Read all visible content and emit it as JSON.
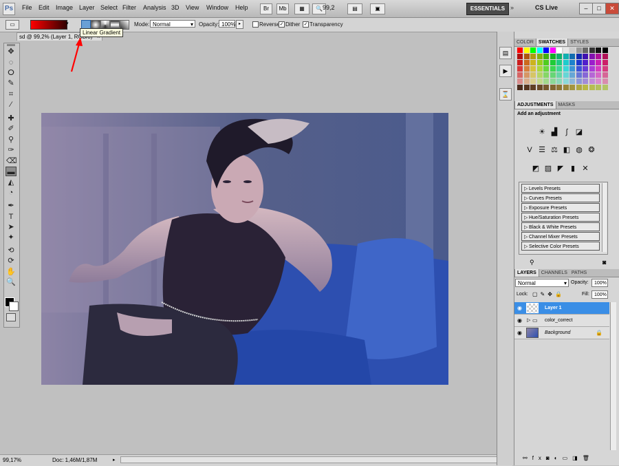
{
  "app": {
    "logo": "Ps"
  },
  "menubar": {
    "menus": [
      "File",
      "Edit",
      "Image",
      "Layer",
      "Select",
      "Filter",
      "Analysis",
      "3D",
      "View",
      "Window",
      "Help"
    ],
    "zoom": "99,2",
    "workspace": "ESSENTIALS",
    "cs_live": "CS Live"
  },
  "options": {
    "mode_label": "Mode:",
    "mode_value": "Normal",
    "opacity_label": "Opacity:",
    "opacity_value": "100%",
    "reverse_label": "Reverse",
    "dither_label": "Dither",
    "transparency_label": "Transparency",
    "reverse_checked": false,
    "dither_checked": true,
    "transparency_checked": true
  },
  "tooltip": "Linear Gradient",
  "document": {
    "tab_title": "sd @ 99,2% (Layer 1, RGB/8)"
  },
  "status": {
    "zoom": "99,17%",
    "doc": "Doc: 1,46M/1,87M"
  },
  "swatches_panel": {
    "tabs": [
      "COLOR",
      "SWATCHES",
      "STYLES"
    ]
  },
  "adjustments_panel": {
    "tabs": [
      "ADJUSTMENTS",
      "MASKS"
    ],
    "heading": "Add an adjustment",
    "presets": [
      "Levels Presets",
      "Curves Presets",
      "Exposure Presets",
      "Hue/Saturation Presets",
      "Black & White Presets",
      "Channel Mixer Presets",
      "Selective Color Presets"
    ]
  },
  "layers_panel": {
    "tabs": [
      "LAYERS",
      "CHANNELS",
      "PATHS"
    ],
    "blend_mode": "Normal",
    "opacity_label": "Opacity:",
    "opacity_value": "100%",
    "lock_label": "Lock:",
    "fill_label": "Fill:",
    "fill_value": "100%",
    "layers": [
      {
        "name": "Layer 1",
        "selected": true
      },
      {
        "name": "color_correct",
        "selected": false
      },
      {
        "name": "Background",
        "selected": false
      }
    ]
  },
  "colors": {
    "accent_selection": "#3a8ee6",
    "gradient_start": "#ff0000",
    "gradient_end": "#300000",
    "annotation_arrow": "#ff0000"
  }
}
